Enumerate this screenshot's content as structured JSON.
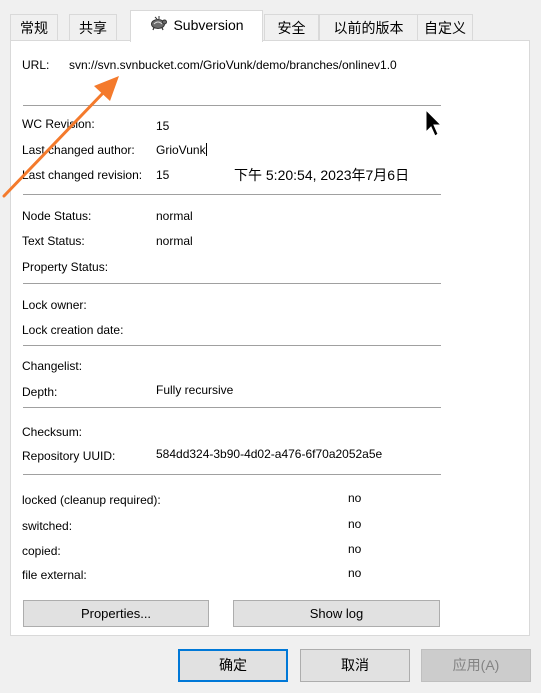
{
  "tabs": [
    {
      "label": "常规",
      "active": false
    },
    {
      "label": "共享",
      "active": false
    },
    {
      "label": "Subversion",
      "active": true,
      "icon": "tortoise-svn-icon"
    },
    {
      "label": "安全",
      "active": false
    },
    {
      "label": "以前的版本",
      "active": false
    },
    {
      "label": "自定义",
      "active": false
    }
  ],
  "url": {
    "label": "URL:",
    "value": "svn://svn.svnbucket.com/GrioVunk/demo/branches/onlinev1.0"
  },
  "revision": {
    "wc_label": "WC Revision:",
    "wc_value": "15",
    "author_label": "Last changed author:",
    "author_value": "GrioVunk",
    "rev_label": "Last changed revision:",
    "rev_value": "15",
    "date_value": "下午 5:20:54, 2023年7月6日"
  },
  "status": {
    "node_label": "Node Status:",
    "node_value": "normal",
    "text_label": "Text Status:",
    "text_value": "normal",
    "prop_label": "Property Status:",
    "prop_value": ""
  },
  "lock": {
    "owner_label": "Lock owner:",
    "owner_value": "",
    "date_label": "Lock creation date:",
    "date_value": ""
  },
  "changelist": {
    "changelist_label": "Changelist:",
    "changelist_value": "",
    "depth_label": "Depth:",
    "depth_value": "Fully recursive"
  },
  "repo": {
    "checksum_label": "Checksum:",
    "checksum_value": "",
    "uuid_label": "Repository UUID:",
    "uuid_value": "584dd324-3b90-4d02-a476-6f70a2052a5e"
  },
  "flags": {
    "locked_label": "locked (cleanup required):",
    "locked_value": "no",
    "switched_label": "switched:",
    "switched_value": "no",
    "copied_label": "copied:",
    "copied_value": "no",
    "external_label": "file external:",
    "external_value": "no"
  },
  "buttons": {
    "properties": "Properties...",
    "show_log": "Show log",
    "ok": "确定",
    "cancel": "取消",
    "apply": "应用(A)"
  },
  "colors": {
    "annotation_arrow": "#f47a2c",
    "primary_border": "#0078d7",
    "separator": "#a0a0a0"
  }
}
